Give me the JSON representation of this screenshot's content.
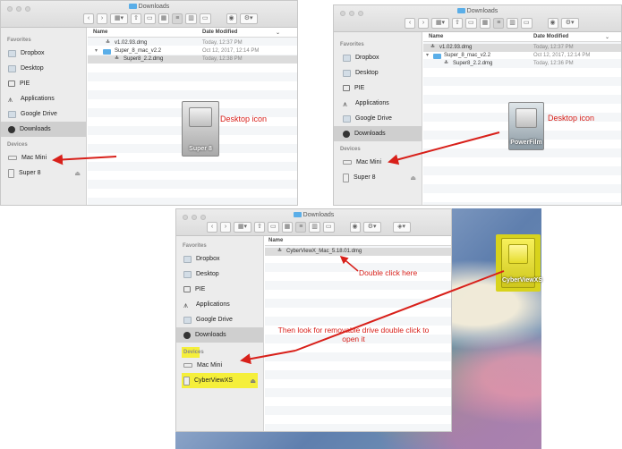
{
  "window1": {
    "title": "Downloads",
    "sidebar_favorites_header": "Favorites",
    "sidebar_favorites": [
      "Dropbox",
      "Desktop",
      "PIE",
      "Applications",
      "Google Drive",
      "Downloads"
    ],
    "sidebar_devices_header": "Devices",
    "sidebar_devices": [
      "Mac Mini",
      "Super 8"
    ],
    "col_name": "Name",
    "col_date": "Date Modified",
    "files": [
      {
        "name": "v1.02.93.dmg",
        "date": "Today, 12:37 PM"
      },
      {
        "name": "Super_8_mac_v2.2",
        "date": "Oct 12, 2017, 12:14 PM"
      },
      {
        "name": "Super8_2.2.dmg",
        "date": "Today, 12:38 PM"
      }
    ],
    "desktop_icon_label": "Super 8",
    "annotation": "Desktop icon"
  },
  "window2": {
    "title": "Downloads",
    "sidebar_favorites_header": "Favorites",
    "sidebar_favorites": [
      "Dropbox",
      "Desktop",
      "PIE",
      "Applications",
      "Google Drive",
      "Downloads"
    ],
    "sidebar_devices_header": "Devices",
    "sidebar_devices": [
      "Mac Mini",
      "Super 8"
    ],
    "col_name": "Name",
    "col_date": "Date Modified",
    "files": [
      {
        "name": "v1.02.93.dmg",
        "date": "Today, 12:37 PM"
      },
      {
        "name": "Super_8_mac_v2.2",
        "date": "Oct 12, 2017, 12:14 PM"
      },
      {
        "name": "Super8_2.2.dmg",
        "date": "Today, 12:36 PM"
      }
    ],
    "desktop_icon_label": "PowerFilm",
    "annotation": "Desktop icon"
  },
  "window3": {
    "title": "Downloads",
    "sidebar_favorites_header": "Favorites",
    "sidebar_favorites": [
      "Dropbox",
      "Desktop",
      "PIE",
      "Applications",
      "Google Drive",
      "Downloads"
    ],
    "sidebar_devices_header": "Devices",
    "sidebar_devices": [
      "Mac Mini",
      "CyberViewXS"
    ],
    "col_name": "Name",
    "files": [
      {
        "name": "CyberViewX_Mac_5.18.01.dmg"
      }
    ],
    "desktop_icon_label": "CyberViewXS",
    "annotation_double_click": "Double click here",
    "annotation_removable": "Then look for removable drive double click to open it"
  },
  "colors": {
    "annotation_red": "#d8201a",
    "highlight_yellow": "#f5ef3a",
    "folder_blue": "#5aaee8"
  }
}
